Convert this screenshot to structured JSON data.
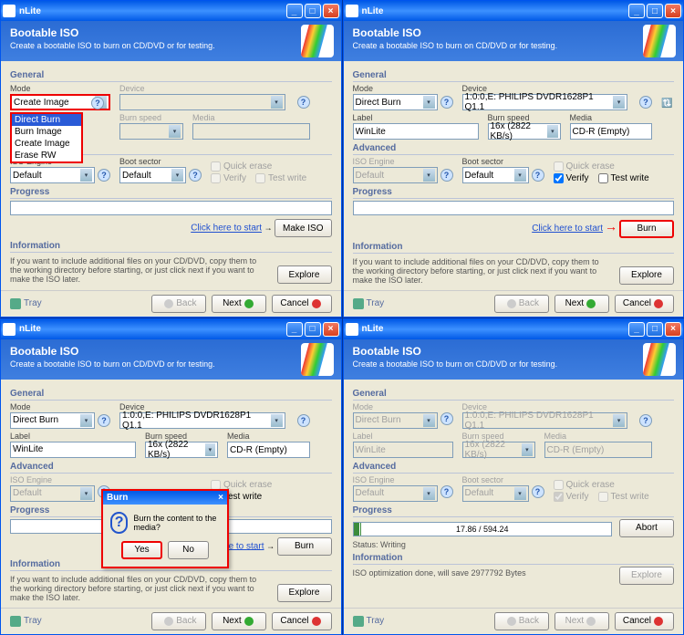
{
  "app_title": "nLite",
  "banner": {
    "title": "Bootable ISO",
    "subtitle": "Create a bootable ISO to burn on CD/DVD or for testing."
  },
  "groups": {
    "general": "General",
    "advanced": "Advanced",
    "progress": "Progress",
    "information": "Information"
  },
  "labels": {
    "mode": "Mode",
    "device": "Device",
    "label": "Label",
    "burn_speed": "Burn speed",
    "media": "Media",
    "iso_engine": "ISO Engine",
    "boot_sector": "Boot sector"
  },
  "checks": {
    "quick_erase": "Quick erase",
    "verify": "Verify",
    "test_write": "Test write"
  },
  "link": "Click here to start",
  "buttons": {
    "make_iso": "Make ISO",
    "burn": "Burn",
    "explore": "Explore",
    "abort": "Abort",
    "back": "Back",
    "next": "Next",
    "cancel": "Cancel",
    "yes": "Yes",
    "no": "No"
  },
  "footer_tray": "Tray",
  "info_text": "If you want to include additional files on your CD/DVD, copy them to the working directory before starting, or just click next if you want to make the ISO later.",
  "info_opt": "ISO optimization done, will save 2977792 Bytes",
  "values": {
    "mode_create": "Create Image",
    "mode_direct": "Direct Burn",
    "device": "1:0:0,E: PHILIPS  DVDR1628P1      Q1.1",
    "label_v": "WinLite",
    "burn_speed": "16x (2822 KB/s)",
    "media_cdr": "CD-R (Empty)",
    "engine_default": "Default",
    "boot_default": "Default"
  },
  "dropdown_items": [
    "Direct Burn",
    "Burn Image",
    "Create Image",
    "Erase RW"
  ],
  "dialog": {
    "title": "Burn",
    "msg": "Burn the content to the media?"
  },
  "progress_text": "17.86 / 594.24",
  "status": "Status: Writing"
}
